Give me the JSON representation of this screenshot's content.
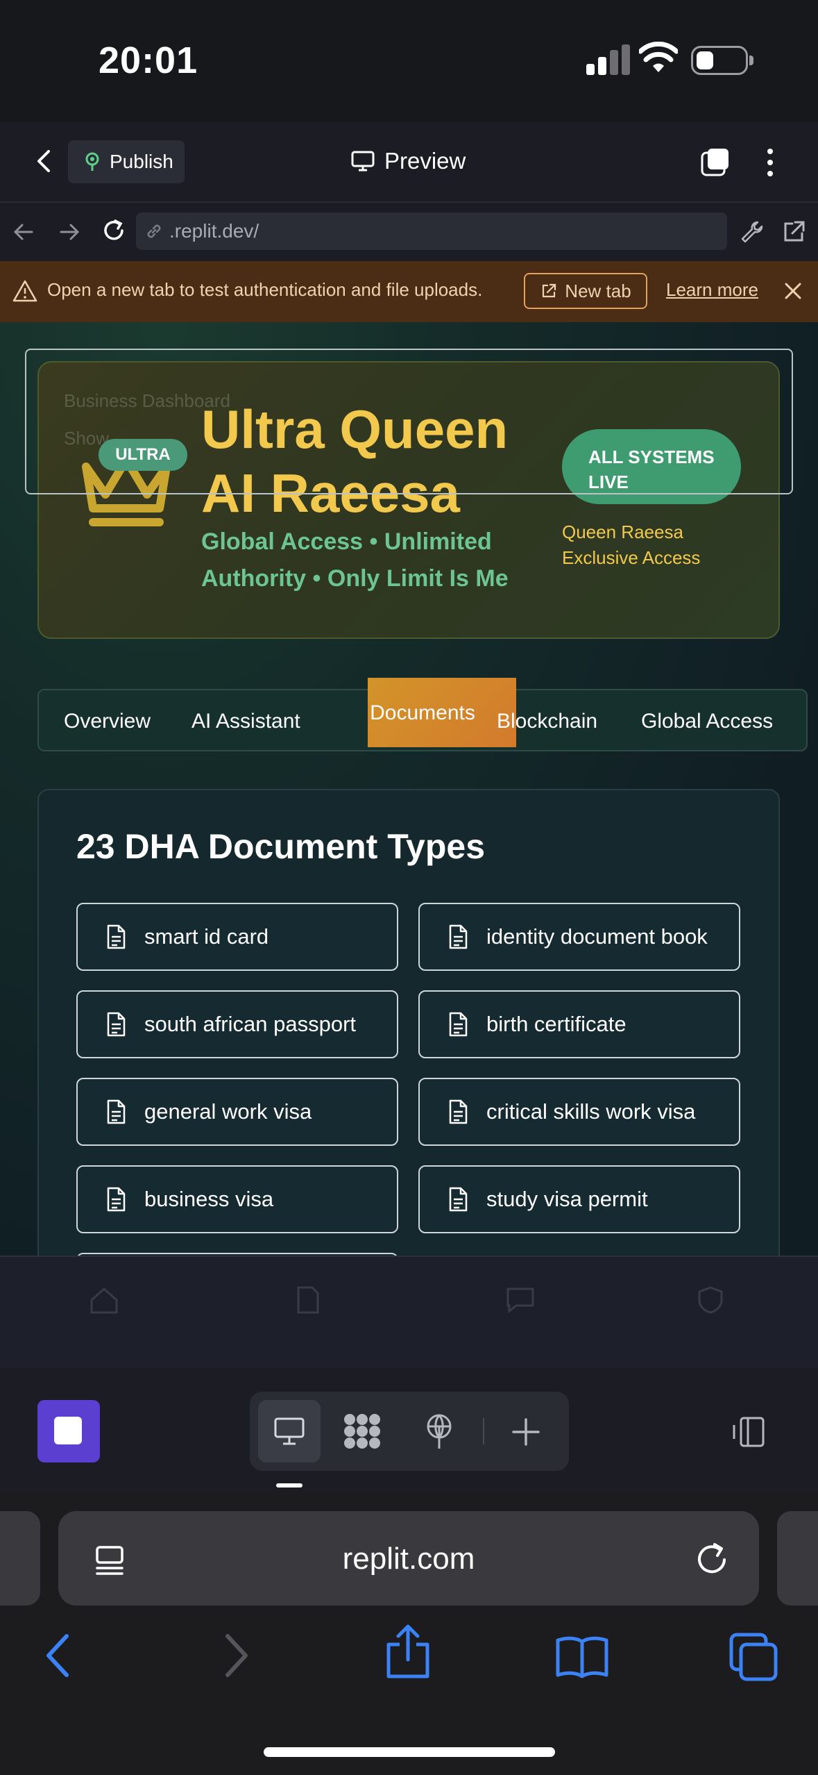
{
  "status_bar": {
    "time": "20:01"
  },
  "replit_header": {
    "publish_label": "Publish",
    "preview_label": "Preview"
  },
  "url_bar": {
    "url": ".replit.dev/"
  },
  "warning": {
    "message": "Open a new tab to test authentication and file uploads.",
    "new_tab_label": "New tab",
    "learn_more_label": "Learn more"
  },
  "hero": {
    "badge": "ULTRA",
    "title": "Ultra Queen AI Raeesa",
    "subtitle": "Global Access • Unlimited Authority • Only Limit Is Me",
    "status_badge": "ALL SYSTEMS LIVE",
    "access_note": "Queen Raeesa Exclusive Access",
    "ghost_text_1": "Business Dashboard",
    "ghost_text_2": "Show"
  },
  "nav_tabs": [
    {
      "label": "Overview",
      "active": false
    },
    {
      "label": "AI Assistant",
      "active": false
    },
    {
      "label": "Documents",
      "active": true
    },
    {
      "label": "Blockchain",
      "active": false
    },
    {
      "label": "Global Access",
      "active": false
    }
  ],
  "documents": {
    "title": "23 DHA Document Types",
    "items": [
      "smart id card",
      "identity document book",
      "south african passport",
      "birth certificate",
      "general work visa",
      "critical skills work visa",
      "business visa",
      "study visa permit"
    ]
  },
  "safari": {
    "domain": "replit.com"
  },
  "colors": {
    "accent_gold": "#f2c94c",
    "accent_green": "#6cc592",
    "active_tab": "#d3882b",
    "warning_bg": "#4b2c14",
    "stop_button": "#5b3fd0",
    "safari_blue": "#3b82f6"
  }
}
